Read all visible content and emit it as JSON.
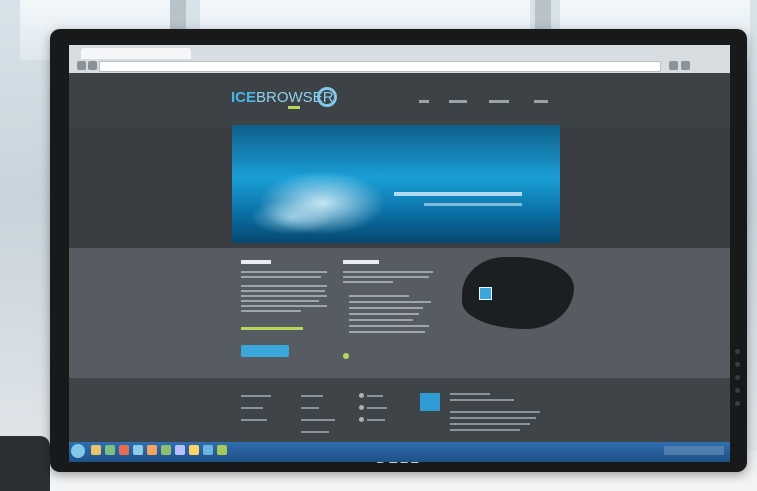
{
  "monitor": {
    "brand": "DELL"
  },
  "website": {
    "logo": {
      "primary": "ICE",
      "secondary": "BROWSER"
    }
  },
  "colors": {
    "brand_blue": "#3aa7dc",
    "accent_green": "#b5d85a",
    "page_dark": "#3d4247",
    "monitor_bezel": "#18191b"
  }
}
